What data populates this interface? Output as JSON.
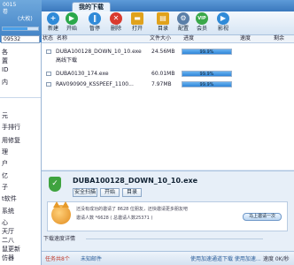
{
  "sidebar": {
    "top_lines": [
      "0015",
      "卷",
      "(大枚)"
    ],
    "progress": 0.7,
    "select_value": "09532",
    "items": [
      "各",
      "置",
      "ID",
      "内",
      "元",
      "手排行",
      "用修复",
      "理",
      "户",
      "亿",
      "子",
      "t软件",
      "系统",
      "心",
      "天厅",
      "二八",
      "鼠更新",
      "仿器"
    ]
  },
  "tab": {
    "label": "我的下载"
  },
  "toolbar": {
    "buttons": [
      {
        "label": "新建",
        "icon": "plus-icon",
        "color": "#2f8ad8"
      },
      {
        "label": "开始",
        "icon": "play-icon",
        "color": "#2aa84a"
      },
      {
        "label": "暂停",
        "icon": "pause-icon",
        "color": "#2f8ad8"
      },
      {
        "label": "删除",
        "icon": "delete-icon",
        "color": "#d93a2e"
      },
      {
        "label": "打开",
        "icon": "folder-icon",
        "color": "#e0a21c"
      },
      {
        "label": "目录",
        "icon": "directory-icon",
        "color": "#e0a21c"
      },
      {
        "label": "配置",
        "icon": "gear-icon",
        "color": "#5a7fa8"
      },
      {
        "label": "会员",
        "icon": "vip-icon",
        "color": "#3aa84a"
      },
      {
        "label": "影视",
        "icon": "film-icon",
        "color": "#2f8ad8"
      }
    ]
  },
  "columns": [
    "状态",
    "名称",
    "文件大小",
    "进度",
    "速度",
    "剩余"
  ],
  "files": [
    {
      "name": "DUBA100128_DOWN_10_10.exe",
      "size": "24.56MB",
      "progress": "99.9%",
      "progress_value": 0.999
    },
    {
      "name": "DUBA0130_174.exe",
      "size": "60.01MB",
      "progress": "99.9%",
      "progress_value": 0.999
    },
    {
      "name": "RAV090909_KSSPEEF_1100...",
      "size": "7.97MB",
      "progress": "99.9%",
      "progress_value": 0.999
    }
  ],
  "file_substatus": "高线下载",
  "detail": {
    "filename": "DUBA100128_DOWN_10_10.exe",
    "buttons": [
      "安全扫描",
      "开始",
      "目录"
    ],
    "ad_lines": [
      "还没有成功的邀请了 8628 位朋友，还快邀请更多朋友吧",
      "邀请人数  *6628  ( 总邀请人数25371 )"
    ],
    "ad_button": "马上邀请一次",
    "speed_label": "下载速度详情"
  },
  "statusbar": {
    "task_count": "任务共8个",
    "unread": "未知邮件",
    "notice": "使用加速通道下载 使用加速...",
    "speed": "速度 0K/秒"
  }
}
